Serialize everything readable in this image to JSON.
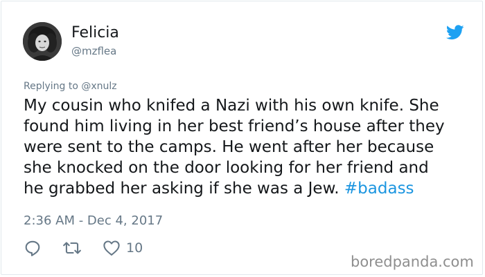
{
  "author": {
    "display_name": "Felicia",
    "handle": "@mzflea"
  },
  "reply": {
    "prefix": "Replying to",
    "mention": "@xnulz"
  },
  "tweet": {
    "lines": [
      "My cousin who knifed a Nazi with his own knife. She",
      "found him living in her best friend’s house after they",
      "were sent to the camps. He went after her because",
      "she knocked on the door looking for her friend and",
      "he grabbed her asking if she was a Jew. "
    ],
    "hashtag": "#badass",
    "timestamp": "2:36 AM - Dec 4, 2017"
  },
  "actions": {
    "reply_icon": "reply-icon",
    "retweet_icon": "retweet-icon",
    "like_icon": "heart-icon",
    "like_count": "10"
  },
  "watermark": "boredpanda.com",
  "colors": {
    "accent": "#1b95e0",
    "text": "#14171a",
    "muted": "#657786",
    "twitter_bird": "#1da1f2"
  }
}
